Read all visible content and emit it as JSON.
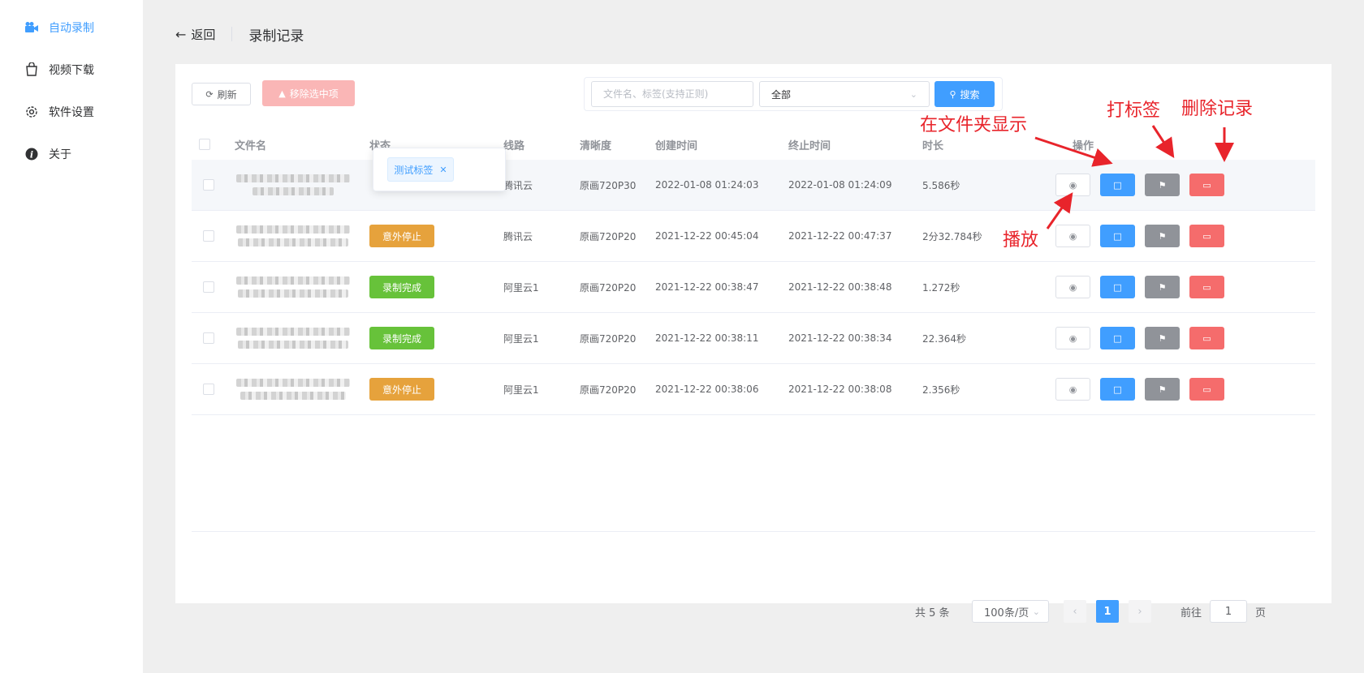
{
  "sidebar": {
    "items": [
      {
        "label": "自动录制",
        "icon": "camera-icon",
        "active": true
      },
      {
        "label": "视频下载",
        "icon": "download-bag-icon",
        "active": false
      },
      {
        "label": "软件设置",
        "icon": "gear-icon",
        "active": false
      },
      {
        "label": "关于",
        "icon": "info-icon",
        "active": false
      }
    ]
  },
  "header": {
    "back_label": "返回",
    "title": "录制记录"
  },
  "toolbar": {
    "refresh_label": "刷新",
    "remove_label": "移除选中项",
    "search_placeholder": "文件名、标签(支持正则)",
    "filter_value": "全部",
    "search_label": "搜索"
  },
  "table": {
    "columns": [
      "文件名",
      "状态",
      "线路",
      "清晰度",
      "创建时间",
      "终止时间",
      "时长",
      "操作"
    ],
    "rows": [
      {
        "status": "",
        "route": "腾讯云",
        "quality": "原画720P30",
        "created": "2022-01-08 01:24:03",
        "ended": "2022-01-08 01:24:09",
        "duration": "5.586秒"
      },
      {
        "status": "意外停止",
        "status_color": "#e6a23c",
        "route": "腾讯云",
        "quality": "原画720P20",
        "created": "2021-12-22 00:45:04",
        "ended": "2021-12-22 00:47:37",
        "duration": "2分32.784秒"
      },
      {
        "status": "录制完成",
        "status_color": "#67c23a",
        "route": "阿里云1",
        "quality": "原画720P20",
        "created": "2021-12-22 00:38:47",
        "ended": "2021-12-22 00:38:48",
        "duration": "1.272秒"
      },
      {
        "status": "录制完成",
        "status_color": "#67c23a",
        "route": "阿里云1",
        "quality": "原画720P20",
        "created": "2021-12-22 00:38:11",
        "ended": "2021-12-22 00:38:34",
        "duration": "22.364秒"
      },
      {
        "status": "意外停止",
        "status_color": "#e6a23c",
        "route": "阿里云1",
        "quality": "原画720P20",
        "created": "2021-12-22 00:38:06",
        "ended": "2021-12-22 00:38:08",
        "duration": "2.356秒"
      }
    ],
    "popover_tag": "测试标签"
  },
  "pagination": {
    "total": "共 5 条",
    "page_size": "100条/页",
    "current_page": "1",
    "goto_label": "前往",
    "goto_value": "1",
    "page_unit": "页"
  },
  "annotations": {
    "show_in_folder": "在文件夹显示",
    "tag": "打标签",
    "delete": "删除记录",
    "play": "播放",
    "color": "#e8242b"
  }
}
